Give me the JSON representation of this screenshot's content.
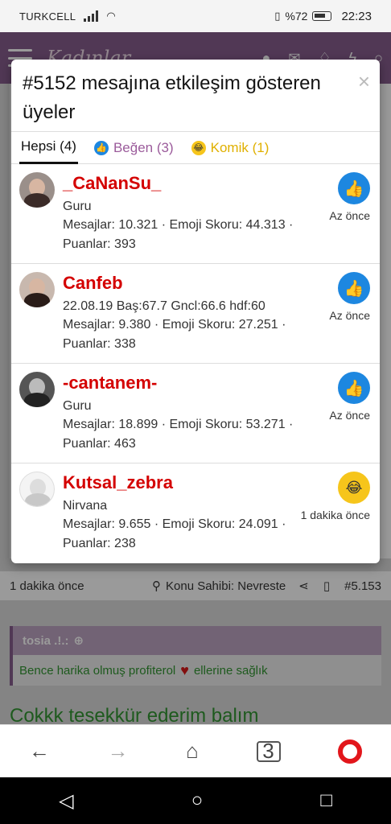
{
  "status_bar": {
    "carrier": "TURKCELL",
    "battery": "%72",
    "time": "22:23"
  },
  "site": {
    "logo_text": "Kadınlar"
  },
  "modal": {
    "title": "#5152 mesajına etkileşim gösteren üyeler",
    "close": "×",
    "tabs": [
      {
        "label": "Hepsi (4)"
      },
      {
        "label": "Beğen (3)"
      },
      {
        "label": "Komik (1)"
      }
    ],
    "members": [
      {
        "name": "_CaNanSu_",
        "title": "Guru",
        "stats": "Mesajlar: 10.321 · Emoji Skoru: 44.313 · Puanlar: 393",
        "reaction": "like",
        "time": "Az önce"
      },
      {
        "name": "Canfeb",
        "title": "22.08.19 Baş:67.7 Gncl:66.6 hdf:60",
        "stats": "Mesajlar: 9.380 · Emoji Skoru: 27.251 · Puanlar: 338",
        "reaction": "like",
        "time": "Az önce"
      },
      {
        "name": "-cantanem-",
        "title": "Guru",
        "stats": "Mesajlar: 18.899 · Emoji Skoru: 53.271 · Puanlar: 463",
        "reaction": "like",
        "time": "Az önce"
      },
      {
        "name": "Kutsal_zebra",
        "title": "Nirvana",
        "stats": "Mesajlar: 9.655 · Emoji Skoru: 24.091 · Puanlar: 238",
        "reaction": "haha",
        "time": "1 dakika önce"
      }
    ]
  },
  "post_footer": {
    "time": "1 dakika önce",
    "author": "Konu Sahibi: Nevreste",
    "post_number": "#5.153"
  },
  "quote": {
    "author": "tosia .!.:",
    "text_before": "Bence harika olmuş profiterol",
    "text_after": "ellerine sağlık"
  },
  "reply_text": "Cokkk tesekkür ederim balım",
  "browser": {
    "tab_count": "3"
  }
}
